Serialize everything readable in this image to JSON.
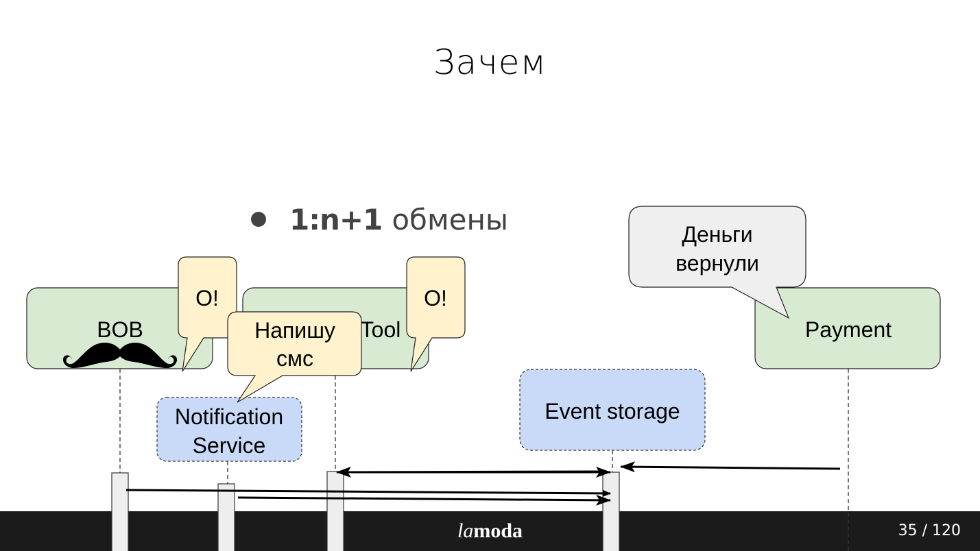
{
  "slide": {
    "title": "Зачем",
    "bullet": {
      "bold": "1:n+1",
      "text": "обмены"
    }
  },
  "diagram": {
    "participants": [
      {
        "id": "bob",
        "label": "BOB",
        "kind": "actor",
        "icon": "mustache-icon",
        "fill": "#d9ead3"
      },
      {
        "id": "tool",
        "label": "Tool",
        "kind": "actor",
        "fill": "#d9ead3"
      },
      {
        "id": "payment",
        "label": "Payment",
        "kind": "actor",
        "fill": "#d9ead3"
      },
      {
        "id": "notification",
        "label_lines": [
          "Notification",
          "Service"
        ],
        "kind": "service",
        "fill": "#c9daf8"
      },
      {
        "id": "event_storage",
        "label": "Event storage",
        "kind": "service",
        "fill": "#c9daf8"
      }
    ],
    "callouts": [
      {
        "id": "bob_o",
        "text": "О!",
        "fill": "#fff2cc"
      },
      {
        "id": "tool_o",
        "text": "О!",
        "fill": "#fff2cc"
      },
      {
        "id": "sms",
        "lines": [
          "Напишу",
          "смс"
        ],
        "fill": "#fff2cc"
      },
      {
        "id": "money",
        "lines": [
          "Деньги",
          "вернули"
        ],
        "fill": "#efefef"
      }
    ],
    "messages": [
      {
        "from": "payment",
        "to": "event_storage"
      },
      {
        "from": "event_storage",
        "to": "tool"
      },
      {
        "from": "tool",
        "to": "event_storage"
      },
      {
        "from": "bob",
        "to": "event_storage"
      },
      {
        "from": "notification",
        "to": "event_storage"
      }
    ]
  },
  "footer": {
    "logo_italic": "la",
    "logo_bold": "moda",
    "page": "35 / 120"
  }
}
